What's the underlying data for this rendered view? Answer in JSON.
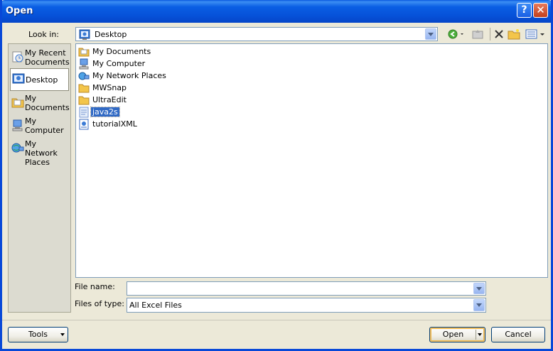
{
  "window": {
    "title": "Open"
  },
  "lookin": {
    "label": "Look in:",
    "value": "Desktop"
  },
  "places": [
    {
      "label": "My Recent Documents",
      "icon": "recent-documents-icon"
    },
    {
      "label": "Desktop",
      "icon": "desktop-icon",
      "selected": true
    },
    {
      "label": "My Documents",
      "icon": "my-documents-icon"
    },
    {
      "label": "My Computer",
      "icon": "my-computer-icon"
    },
    {
      "label": "My Network Places",
      "icon": "network-places-icon"
    }
  ],
  "files": [
    {
      "name": "My Documents",
      "icon": "my-documents-icon"
    },
    {
      "name": "My Computer",
      "icon": "my-computer-icon"
    },
    {
      "name": "My Network Places",
      "icon": "network-places-icon"
    },
    {
      "name": "MWSnap",
      "icon": "folder-icon"
    },
    {
      "name": "UltraEdit",
      "icon": "folder-icon"
    },
    {
      "name": "java2s",
      "icon": "shortcut-icon",
      "selected": true
    },
    {
      "name": "tutorialXML",
      "icon": "xml-file-icon"
    }
  ],
  "filename": {
    "label": "File name:",
    "value": ""
  },
  "filetype": {
    "label": "Files of type:",
    "value": "All Excel Files"
  },
  "buttons": {
    "tools": "Tools",
    "open": "Open",
    "cancel": "Cancel"
  },
  "colors": {
    "titlebar": "#0a5ee4",
    "selection": "#316ac5",
    "dialog_bg": "#ece9d8"
  }
}
